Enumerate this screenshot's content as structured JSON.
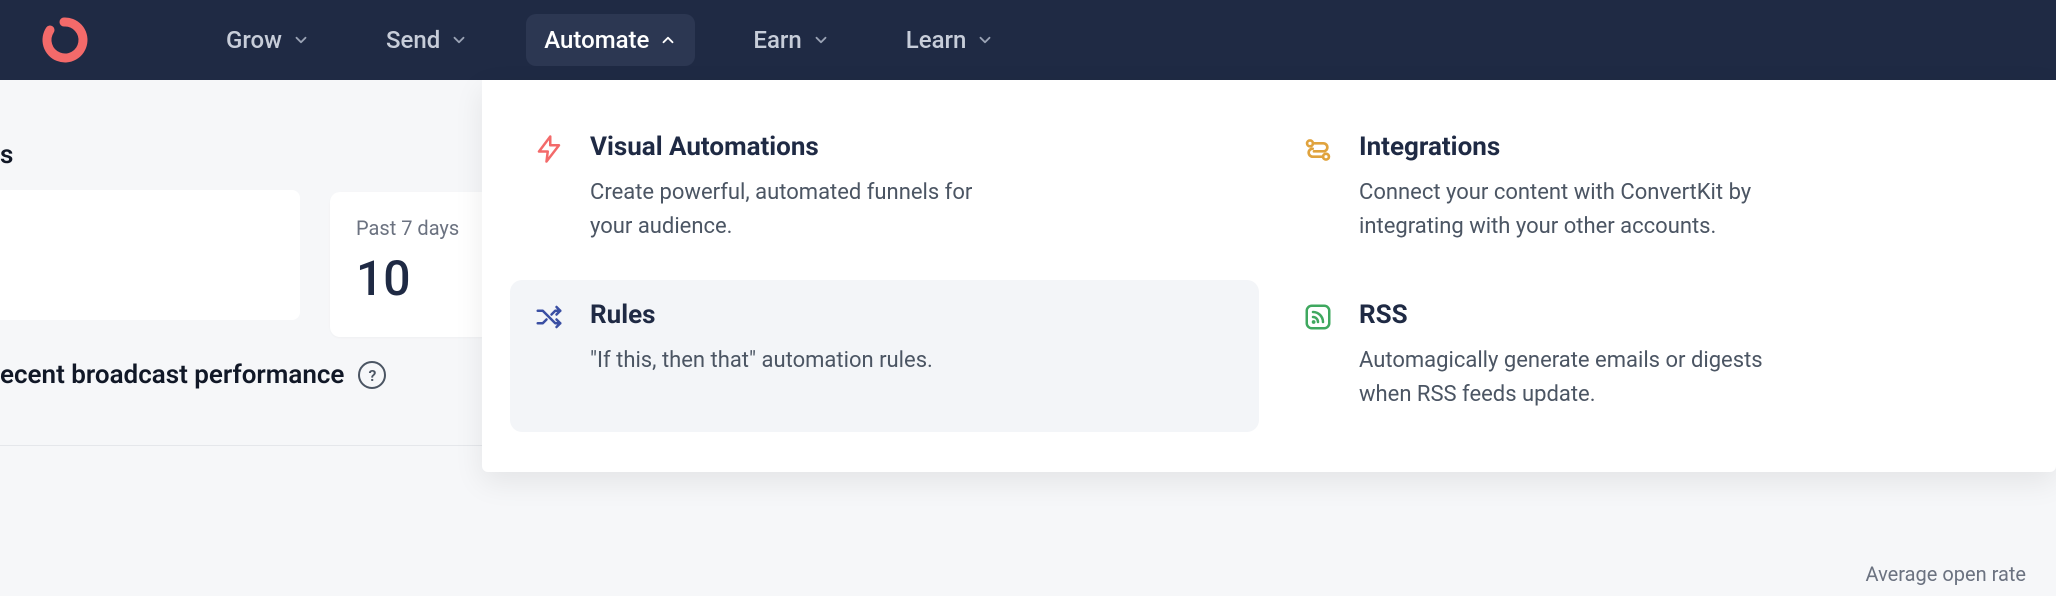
{
  "nav": {
    "items": [
      {
        "label": "Grow"
      },
      {
        "label": "Send"
      },
      {
        "label": "Automate"
      },
      {
        "label": "Earn"
      },
      {
        "label": "Learn"
      }
    ]
  },
  "dashboard": {
    "truncated_heading": "s",
    "stat_label": "Past 7 days",
    "stat_value": "10",
    "section_title": "ecent broadcast performance",
    "help_glyph": "?",
    "avg_open_label": "Average open rate"
  },
  "megamenu": {
    "items": [
      {
        "title": "Visual Automations",
        "desc": "Create powerful, automated funnels for your audience."
      },
      {
        "title": "Integrations",
        "desc": "Connect your content with ConvertKit by integrating with your other accounts."
      },
      {
        "title": "Rules",
        "desc": "\"If this, then that\" automation rules."
      },
      {
        "title": "RSS",
        "desc": "Automagically generate emails or digests when RSS feeds update."
      }
    ]
  }
}
